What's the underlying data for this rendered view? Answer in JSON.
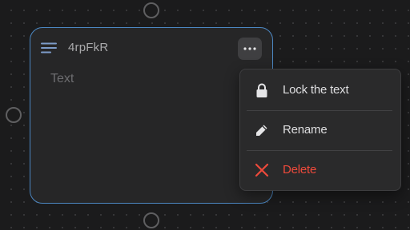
{
  "node": {
    "title": "4rpFkR",
    "placeholder_text": "Text",
    "icon": "text-lines-icon",
    "more_icon": "more-horizontal-icon",
    "border_color": "#4c87c2"
  },
  "context_menu": {
    "items": [
      {
        "label": "Lock the text",
        "icon": "lock-icon",
        "danger": false
      },
      {
        "label": "Rename",
        "icon": "pencil-icon",
        "danger": false
      },
      {
        "label": "Delete",
        "icon": "close-x-icon",
        "danger": true
      }
    ],
    "danger_color": "#ee4a3b"
  }
}
